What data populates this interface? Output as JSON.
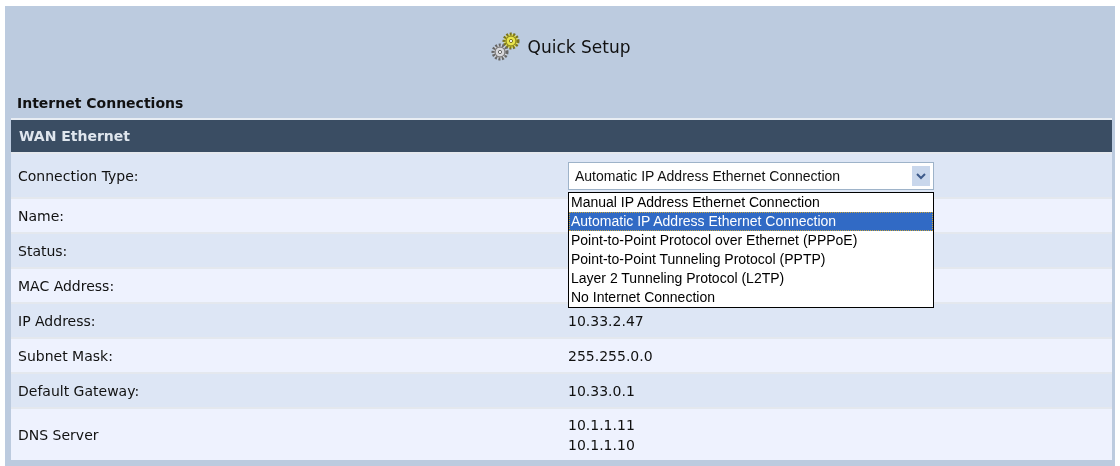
{
  "header": {
    "title": "Quick Setup"
  },
  "section_title": "Internet Connections",
  "panel": {
    "title": "WAN Ethernet",
    "connection_type": {
      "label": "Connection Type:",
      "value": "Automatic IP Address Ethernet Connection",
      "expanded": true,
      "options": [
        {
          "label": "Manual IP Address Ethernet Connection",
          "selected": false
        },
        {
          "label": "Automatic IP Address Ethernet Connection",
          "selected": true
        },
        {
          "label": "Point-to-Point Protocol over Ethernet (PPPoE)",
          "selected": false
        },
        {
          "label": "Point-to-Point Tunneling Protocol (PPTP)",
          "selected": false
        },
        {
          "label": "Layer 2 Tunneling Protocol (L2TP)",
          "selected": false
        },
        {
          "label": "No Internet Connection",
          "selected": false
        }
      ]
    },
    "rows": [
      {
        "label": "Name:",
        "values": []
      },
      {
        "label": "Status:",
        "values": []
      },
      {
        "label": "MAC Address:",
        "values": []
      },
      {
        "label": "IP Address:",
        "values": [
          "10.33.2.47"
        ]
      },
      {
        "label": "Subnet Mask:",
        "values": [
          "255.255.0.0"
        ]
      },
      {
        "label": "Default Gateway:",
        "values": [
          "10.33.0.1"
        ]
      },
      {
        "label": "DNS Server",
        "values": [
          "10.1.1.11",
          "10.1.1.10"
        ]
      }
    ]
  }
}
